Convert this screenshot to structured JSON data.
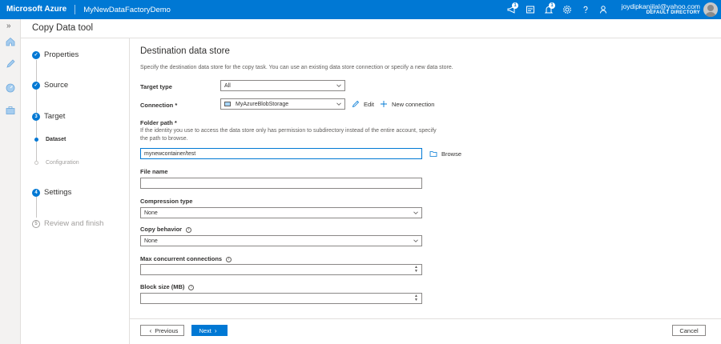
{
  "app": {
    "brand": "Microsoft Azure",
    "factory_name": "MyNewDataFactoryDemo"
  },
  "topbar": {
    "notification_badges": [
      "1",
      "1"
    ],
    "user_email": "joydipkanjilal@yahoo.com",
    "directory": "DEFAULT DIRECTORY"
  },
  "rail": {
    "toggle": "»"
  },
  "tool": {
    "title": "Copy Data tool"
  },
  "steps": {
    "items": [
      {
        "number": "✓",
        "label": "Properties"
      },
      {
        "number": "✓",
        "label": "Source"
      },
      {
        "number": "3",
        "label": "Target"
      },
      {
        "number": "4",
        "label": "Settings"
      },
      {
        "number": "5",
        "label": "Review and finish"
      }
    ],
    "substeps": [
      {
        "label": "Dataset"
      },
      {
        "label": "Configuration"
      }
    ]
  },
  "form": {
    "title": "Destination data store",
    "description": "Specify the destination data store for the copy task. You can use an existing data store connection or specify a new data store.",
    "target_type": {
      "label": "Target type",
      "value": "All"
    },
    "connection": {
      "label": "Connection *",
      "value": "MyAzureBlobStorage",
      "edit_label": "Edit",
      "new_label": "New connection"
    },
    "folder_path": {
      "label": "Folder path *",
      "help": "If the identity you use to access the data store only has permission to subdirectory instead of the entire account, specify the path to browse.",
      "value": "mynewcontainer/test",
      "browse_label": "Browse"
    },
    "file_name": {
      "label": "File name",
      "value": ""
    },
    "compression_type": {
      "label": "Compression type",
      "value": "None"
    },
    "copy_behavior": {
      "label": "Copy behavior",
      "value": "None"
    },
    "max_connections": {
      "label": "Max concurrent connections",
      "value": ""
    },
    "block_size": {
      "label": "Block size (MB)",
      "value": ""
    },
    "info_glyph": "i"
  },
  "footer": {
    "previous_label": "Previous",
    "next_label": "Next",
    "cancel_label": "Cancel"
  },
  "colors": {
    "accent": "#0078d4"
  }
}
